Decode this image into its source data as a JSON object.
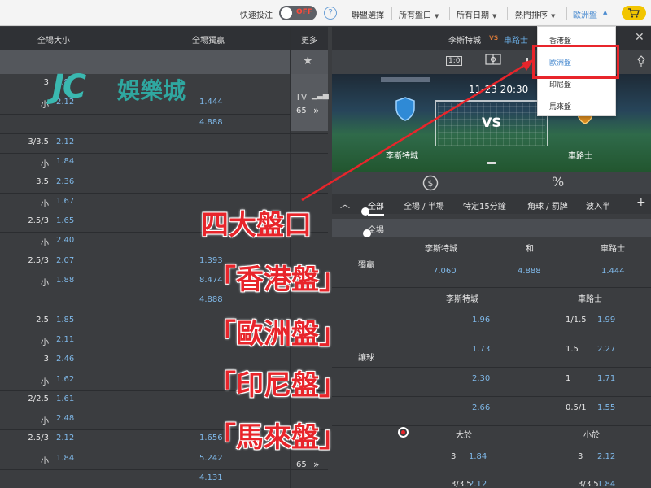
{
  "topbar": {
    "quickbet_label": "快速投注",
    "toggle_text": "OFF",
    "help_icon": "?",
    "menus": [
      {
        "label": "聯盟選擇"
      },
      {
        "label": "所有盤口"
      },
      {
        "label": "所有日期"
      },
      {
        "label": "熱門排序"
      }
    ],
    "odds_selected": "歐洲盤",
    "cart_icon": "cart-icon"
  },
  "dropdown": {
    "options": [
      "香港盤",
      "歐洲盤",
      "印尼盤",
      "馬來盤"
    ],
    "selected": "歐洲盤"
  },
  "left": {
    "headers": {
      "ou": "全場大小",
      "ml": "全場獨贏",
      "more": "更多"
    },
    "tv": {
      "label": "TV",
      "count": "65",
      "arrow": "»"
    },
    "tv2": {
      "count": "65",
      "arrow": "»"
    },
    "rows": [
      {
        "hc": "3",
        "o1": "1.8",
        "o2": ""
      },
      {
        "hc": "小",
        "o1": "2.12",
        "o2": "1.444"
      },
      {
        "hc": "",
        "o1": "",
        "o2": "4.888"
      },
      {
        "hc": "3/3.5",
        "o1": "2.12",
        "o2": ""
      },
      {
        "hc": "小",
        "o1": "1.84",
        "o2": ""
      },
      {
        "hc": "3.5",
        "o1": "2.36",
        "o2": ""
      },
      {
        "hc": "小",
        "o1": "1.67",
        "o2": ""
      },
      {
        "hc": "2.5/3",
        "o1": "1.65",
        "o2": ""
      },
      {
        "hc": "小",
        "o1": "2.40",
        "o2": ""
      },
      {
        "hc": "2.5/3",
        "o1": "2.07",
        "o2": "1.393"
      },
      {
        "hc": "小",
        "o1": "1.88",
        "o2": "8.474"
      },
      {
        "hc": "",
        "o1": "",
        "o2": "4.888"
      },
      {
        "hc": "2.5",
        "o1": "1.85",
        "o2": ""
      },
      {
        "hc": "小",
        "o1": "2.11",
        "o2": ""
      },
      {
        "hc": "3",
        "o1": "2.46",
        "o2": ""
      },
      {
        "hc": "小",
        "o1": "1.62",
        "o2": ""
      },
      {
        "hc": "2/2.5",
        "o1": "1.61",
        "o2": ""
      },
      {
        "hc": "小",
        "o1": "2.48",
        "o2": ""
      },
      {
        "hc": "2.5/3",
        "o1": "2.12",
        "o2": "1.656"
      },
      {
        "hc": "小",
        "o1": "1.84",
        "o2": "5.242"
      },
      {
        "hc": "",
        "o1": "",
        "o2": "4.131"
      }
    ]
  },
  "logo": {
    "jc": "JC",
    "brand": "娛樂城"
  },
  "right": {
    "header": {
      "home": "李斯特城",
      "vs": "vs",
      "away": "車路士",
      "close": "✕"
    },
    "viewbar": {
      "score_icon": "1:0"
    },
    "scene": {
      "time": "11-23 20:30",
      "vs": "VS",
      "home": "李斯特城",
      "away": "車路士"
    },
    "tabs": [
      "全部",
      "全場 / 半場",
      "特定15分鐘",
      "角球 / 罰牌",
      "波入半"
    ],
    "plus": "+",
    "section1": "全場",
    "ml": {
      "label": "獨贏",
      "home": "李斯特城",
      "draw": "和",
      "away": "車路士",
      "home_odds": "7.060",
      "draw_odds": "4.888",
      "away_odds": "1.444"
    },
    "hcp": {
      "label": "讓球",
      "home": "李斯特城",
      "away": "車路士",
      "rows": [
        {
          "home_hc": "",
          "home_odds": "1.96",
          "away_hc": "1/1.5",
          "away_odds": "1.99"
        },
        {
          "home_hc": "",
          "home_odds": "1.73",
          "away_hc": "1.5",
          "away_odds": "2.27"
        },
        {
          "home_hc": "",
          "home_odds": "2.30",
          "away_hc": "1",
          "away_odds": "1.71"
        },
        {
          "home_hc": "",
          "home_odds": "2.66",
          "away_hc": "0.5/1",
          "away_odds": "1.55"
        }
      ]
    },
    "ou": {
      "over": "大於",
      "under": "小於",
      "rows": [
        {
          "over_hc": "3",
          "over_odds": "1.84",
          "under_hc": "3",
          "under_odds": "2.12"
        },
        {
          "over_hc": "3/3.5",
          "over_odds": "2.12",
          "under_hc": "3/3.5",
          "under_odds": "1.84"
        }
      ]
    }
  },
  "annotation": {
    "title": "四大盤口",
    "items": [
      "「香港盤」",
      "「歐洲盤」",
      "「印尼盤」",
      "「馬來盤」"
    ],
    "color": "#e8252b"
  }
}
